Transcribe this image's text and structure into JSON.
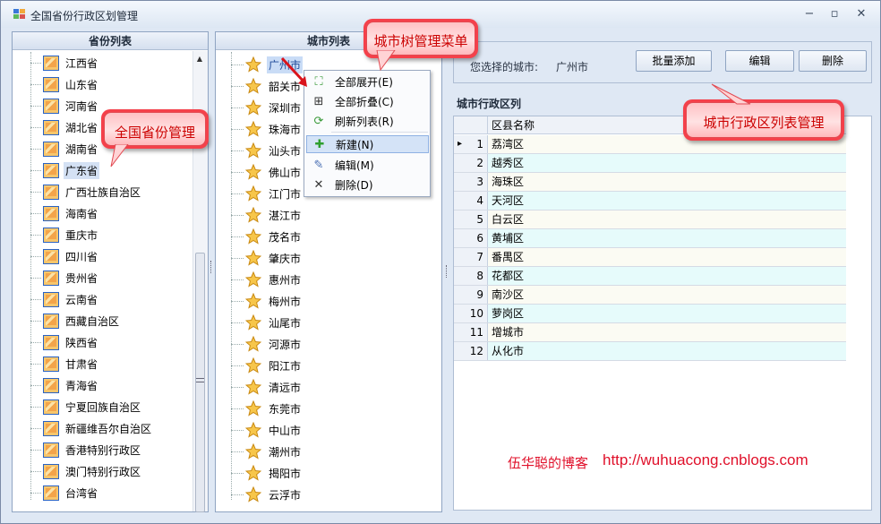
{
  "window": {
    "title": "全国省份行政区划管理"
  },
  "province_panel": {
    "header": "省份列表",
    "items": [
      "江西省",
      "山东省",
      "河南省",
      "湖北省",
      "湖南省",
      "广东省",
      "广西壮族自治区",
      "海南省",
      "重庆市",
      "四川省",
      "贵州省",
      "云南省",
      "西藏自治区",
      "陕西省",
      "甘肃省",
      "青海省",
      "宁夏回族自治区",
      "新疆维吾尔自治区",
      "香港特别行政区",
      "澳门特别行政区",
      "台湾省"
    ],
    "selected_index": 5
  },
  "city_panel": {
    "header": "城市列表",
    "items": [
      "广州市",
      "韶关市",
      "深圳市",
      "珠海市",
      "汕头市",
      "佛山市",
      "江门市",
      "湛江市",
      "茂名市",
      "肇庆市",
      "惠州市",
      "梅州市",
      "汕尾市",
      "河源市",
      "阳江市",
      "清远市",
      "东莞市",
      "中山市",
      "潮州市",
      "揭阳市",
      "云浮市"
    ],
    "selected_index": 0
  },
  "context_menu": {
    "items": [
      {
        "label": "全部展开(E)",
        "icon": "expand-all-icon"
      },
      {
        "label": "全部折叠(C)",
        "icon": "collapse-all-icon"
      },
      {
        "label": "刷新列表(R)",
        "icon": "refresh-icon"
      },
      {
        "label": "新建(N)",
        "icon": "add-icon"
      },
      {
        "label": "编辑(M)",
        "icon": "edit-icon"
      },
      {
        "label": "删除(D)",
        "icon": "delete-icon"
      }
    ],
    "highlighted_index": 3
  },
  "selected_city": {
    "label": "您选择的城市:",
    "value": "广州市"
  },
  "buttons": {
    "batch_add": "批量添加",
    "edit": "编辑",
    "delete": "删除"
  },
  "district_grid": {
    "title": "城市行政区列",
    "column_header": "区县名称",
    "rows": [
      {
        "no": "1",
        "name": "荔湾区"
      },
      {
        "no": "2",
        "name": "越秀区"
      },
      {
        "no": "3",
        "name": "海珠区"
      },
      {
        "no": "4",
        "name": "天河区"
      },
      {
        "no": "5",
        "name": "白云区"
      },
      {
        "no": "6",
        "name": "黄埔区"
      },
      {
        "no": "7",
        "name": "番禺区"
      },
      {
        "no": "8",
        "name": "花都区"
      },
      {
        "no": "9",
        "name": "南沙区"
      },
      {
        "no": "10",
        "name": "萝岗区"
      },
      {
        "no": "11",
        "name": "增城市"
      },
      {
        "no": "12",
        "name": "从化市"
      }
    ]
  },
  "callouts": {
    "province": "全国省份管理",
    "city_menu": "城市树管理菜单",
    "district": "城市行政区列表管理"
  },
  "blog": {
    "author": "伍华聪的博客",
    "url": "http://wuhuacong.cnblogs.com"
  },
  "colors": {
    "row_alt": "#e6fbfb",
    "row_plain": "#fbfbf3",
    "callout": "#f5404a",
    "blog_text": "#e0102a"
  }
}
